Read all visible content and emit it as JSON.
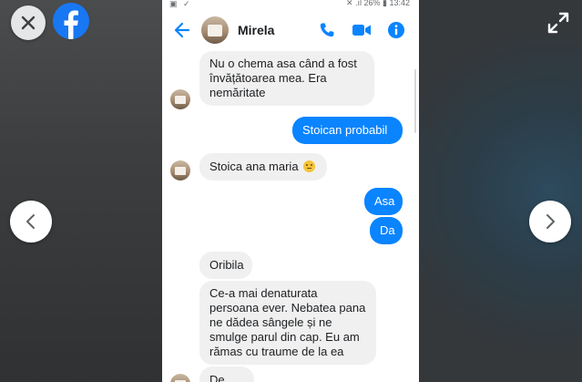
{
  "statusbar": {
    "icons": "▣ ✓",
    "right": "✕ .ıl 26% ▮ 13:42"
  },
  "header": {
    "contact_name": "Mirela"
  },
  "messages": [
    {
      "dir": "in",
      "text": "Nu o chema asa când a fost învățătoarea mea. Era nemăritate"
    },
    {
      "dir": "out",
      "text": "Stoican probabil"
    },
    {
      "dir": "in",
      "text": "Stoica ana maria"
    },
    {
      "dir": "out",
      "text": "Asa"
    },
    {
      "dir": "out",
      "text": "Da"
    },
    {
      "dir": "in",
      "text": "Oribila"
    },
    {
      "dir": "in",
      "text": "Ce-a mai denaturata persoana ever. Nebatea pana ne dădea sângele și ne smulge parul din cap. Eu am rămas cu traume de la ea"
    },
    {
      "dir": "in",
      "text": "De ce?"
    }
  ],
  "icons": {
    "close": "close-icon",
    "brand": "facebook-logo",
    "expand": "expand-icon",
    "back": "back-arrow-icon",
    "call": "phone-icon",
    "video": "video-camera-icon",
    "info": "info-icon",
    "prev": "chevron-left-icon",
    "next": "chevron-right-icon",
    "emoji": "smirk-emoji"
  },
  "colors": {
    "messenger_blue": "#0a84ff",
    "facebook_blue": "#1877f2",
    "incoming_bubble": "#f0f0f0"
  }
}
